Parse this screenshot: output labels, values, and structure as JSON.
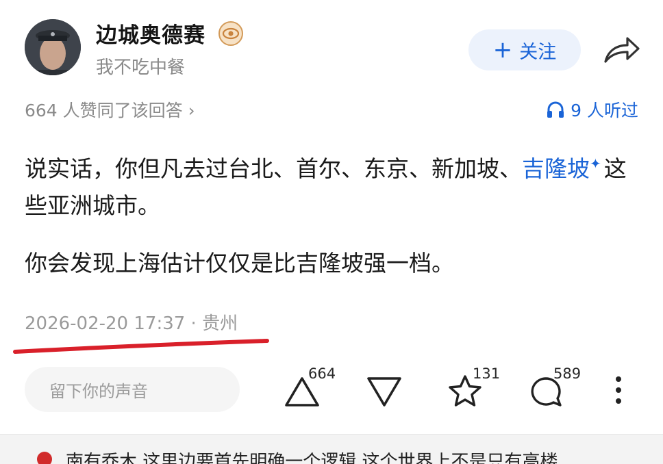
{
  "author": {
    "name": "边城奥德赛",
    "bio": "我不吃中餐",
    "follow_label": "关注"
  },
  "meta": {
    "likes_text": "664 人赞同了该回答",
    "listen_text": "9 人听过"
  },
  "content": {
    "p1_before": "说实话，你但凡去过台北、首尔、东京、新加坡、",
    "p1_link": "吉隆坡",
    "p1_after": "这些亚洲城市。",
    "p2": "你会发现上海估计仅仅是比吉隆坡强一档。"
  },
  "timestamp": "2026-02-20 17:37 · 贵州",
  "actions": {
    "comment_placeholder": "留下你的声音",
    "upvote_count": "664",
    "favorite_count": "131",
    "comment_count": "589"
  },
  "next_comment": {
    "text": "南有乔木  这里边要首先明确一个逻辑  这个世界上不是只有高楼"
  },
  "colors": {
    "accent": "#1a64d7",
    "annotation_red": "#d9202a"
  }
}
